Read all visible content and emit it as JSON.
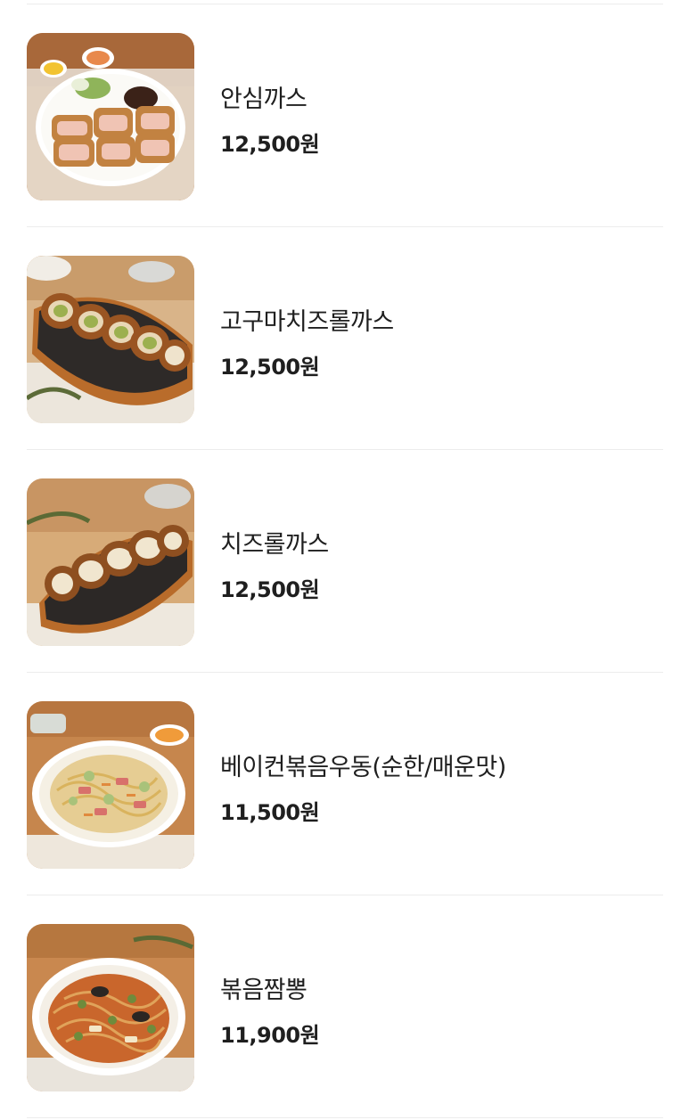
{
  "menu": {
    "items": [
      {
        "name": "안심까스",
        "price": "12,500원",
        "image": "tonkatsu-fillet-plate"
      },
      {
        "name": "고구마치즈롤까스",
        "price": "12,500원",
        "image": "sweet-potato-cheese-roll-katsu"
      },
      {
        "name": "치즈롤까스",
        "price": "12,500원",
        "image": "cheese-roll-katsu"
      },
      {
        "name": "베이컨볶음우동(순한/매운맛)",
        "price": "11,500원",
        "image": "bacon-stir-fried-udon"
      },
      {
        "name": "볶음짬뽕",
        "price": "11,900원",
        "image": "stir-fried-jjamppong"
      }
    ]
  }
}
